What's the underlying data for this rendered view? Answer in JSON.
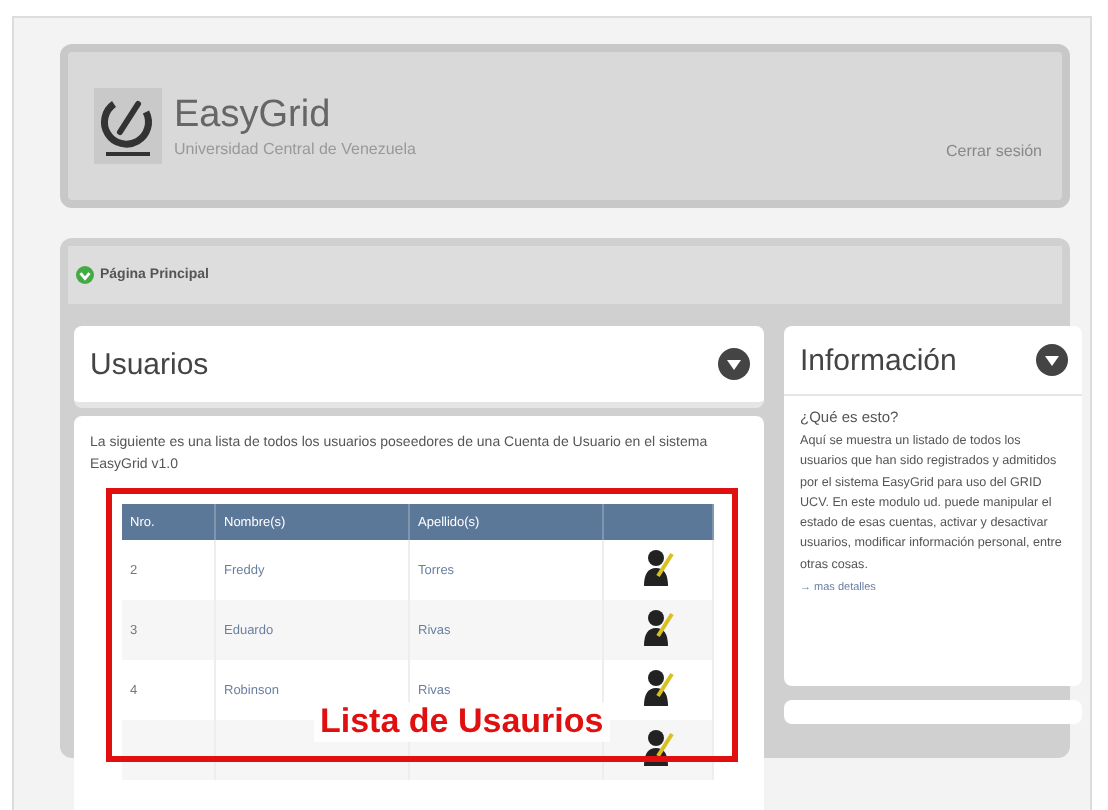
{
  "header": {
    "title": "EasyGrid",
    "subtitle": "Universidad Central de Venezuela",
    "logout": "Cerrar sesión"
  },
  "breadcrumb": {
    "label": "Página Principal"
  },
  "users_panel": {
    "title": "Usuarios",
    "intro": "La siguiente es una lista de todos los usuarios poseedores de una Cuenta de Usuario en el sistema EasyGrid v1.0",
    "table": {
      "columns": [
        "Nro.",
        "Nombre(s)",
        "Apellido(s)"
      ],
      "rows": [
        {
          "kind": "user",
          "number": "2",
          "first": "Freddy",
          "last": "Torres"
        },
        {
          "kind": "user",
          "number": "3",
          "first": "Eduardo",
          "last": "Rivas"
        },
        {
          "kind": "user",
          "number": "4",
          "first": "Robinson",
          "last": "Rivas"
        },
        {
          "kind": "covered"
        }
      ]
    },
    "annotation": "Lista de Usaurios"
  },
  "info_panel": {
    "title": "Información",
    "question": "¿Qué es esto?",
    "text": "Aquí se muestra un listado de todos los usuarios que han sido registrados y admitidos por el sistema EasyGrid para uso del GRID UCV. En este modulo ud. puede manipular el estado de esas cuentas, activar y desactivar usuarios, modificar información personal, entre otras cosas.",
    "link": "→ mas detalles"
  }
}
